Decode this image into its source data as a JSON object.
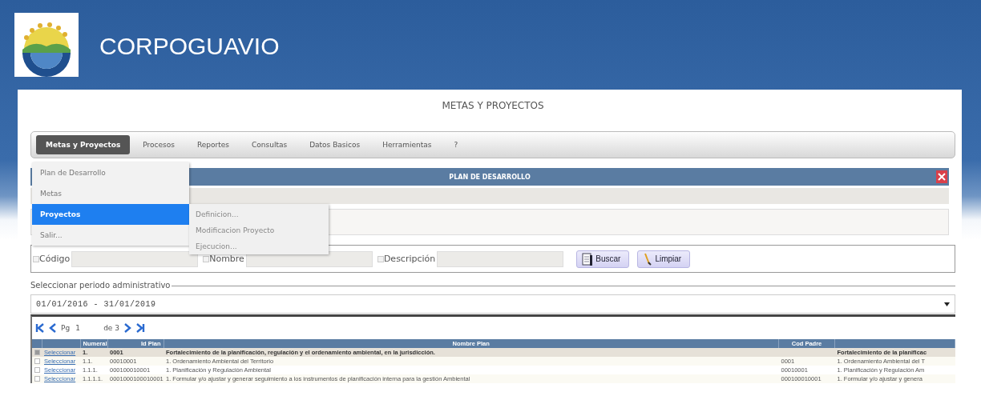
{
  "header": {
    "title": "CORPOGUAVIO"
  },
  "page_title": "METAS Y PROYECTOS",
  "menu": [
    {
      "label": "Metas y Proyectos",
      "selected": true
    },
    {
      "label": "Procesos",
      "selected": false
    },
    {
      "label": "Reportes",
      "selected": false
    },
    {
      "label": "Consultas",
      "selected": false
    },
    {
      "label": "Datos Basicos",
      "selected": false
    },
    {
      "label": "Herramientas",
      "selected": false
    },
    {
      "label": "?",
      "selected": false
    }
  ],
  "dropdown": [
    {
      "label": "Plan de Desarrollo",
      "selected": false
    },
    {
      "label": "Metas",
      "selected": false
    },
    {
      "label": "Proyectos",
      "selected": true
    },
    {
      "label": "Salir...",
      "selected": false
    }
  ],
  "submenu": [
    {
      "label": "Definicion..."
    },
    {
      "label": "Modificacion Proyecto"
    },
    {
      "label": "Ejecucion..."
    }
  ],
  "panel": {
    "title": "PLAN DE DESARROLLO"
  },
  "filters": [
    {
      "label": "Código",
      "checked": false
    },
    {
      "label": "Nombre",
      "checked": false
    },
    {
      "label": "Descripción",
      "checked": false
    }
  ],
  "buttons": [
    {
      "label": "Buscar",
      "kind": "search"
    },
    {
      "label": "Limpiar",
      "kind": "clear"
    }
  ],
  "period": {
    "legend": "Seleccionar periodo administrativo",
    "value": "01/01/2016 - 31/01/2019"
  },
  "pager": {
    "prefix": "Pg",
    "page": "1",
    "total": "de 3"
  },
  "table": {
    "columns": [
      "Numeral",
      "Id Plan",
      "Nombre Plan",
      "Cod Padre"
    ],
    "rows": [
      {
        "selected": true,
        "link": "Seleccionar",
        "numeral": "1.",
        "id": "0001",
        "name": "Fortalecimiento de la planificación, regulación y el ordenamiento ambiental, en la jurisdicción.",
        "column_6": "Fortalecimiento de la planificac"
      },
      {
        "selected": false,
        "link": "Seleccionar",
        "numeral": "1.1.",
        "id": "00010001",
        "name": "1. Ordenamiento Ambiental del Territorio",
        "parent": "0001",
        "column_6": "1. Ordenamiento Ambiental del T"
      },
      {
        "selected": false,
        "link": "Seleccionar",
        "numeral": "1.1.1.",
        "id": "000100010001",
        "name": "1. Planificación y Regulación Ambiental",
        "parent": "00010001",
        "column_6": "1. Planificación y Regulación Am"
      },
      {
        "selected": false,
        "link": "Seleccionar",
        "numeral": "1.1.1.1.",
        "id": "0001000100010001",
        "name": "1. Formular y/o ajustar y generar seguimiento a los instrumentos de planificación interna para la gestión Ambiental",
        "parent": "000100010001",
        "column_6": "1. Formular y/o ajustar y genera"
      }
    ]
  }
}
